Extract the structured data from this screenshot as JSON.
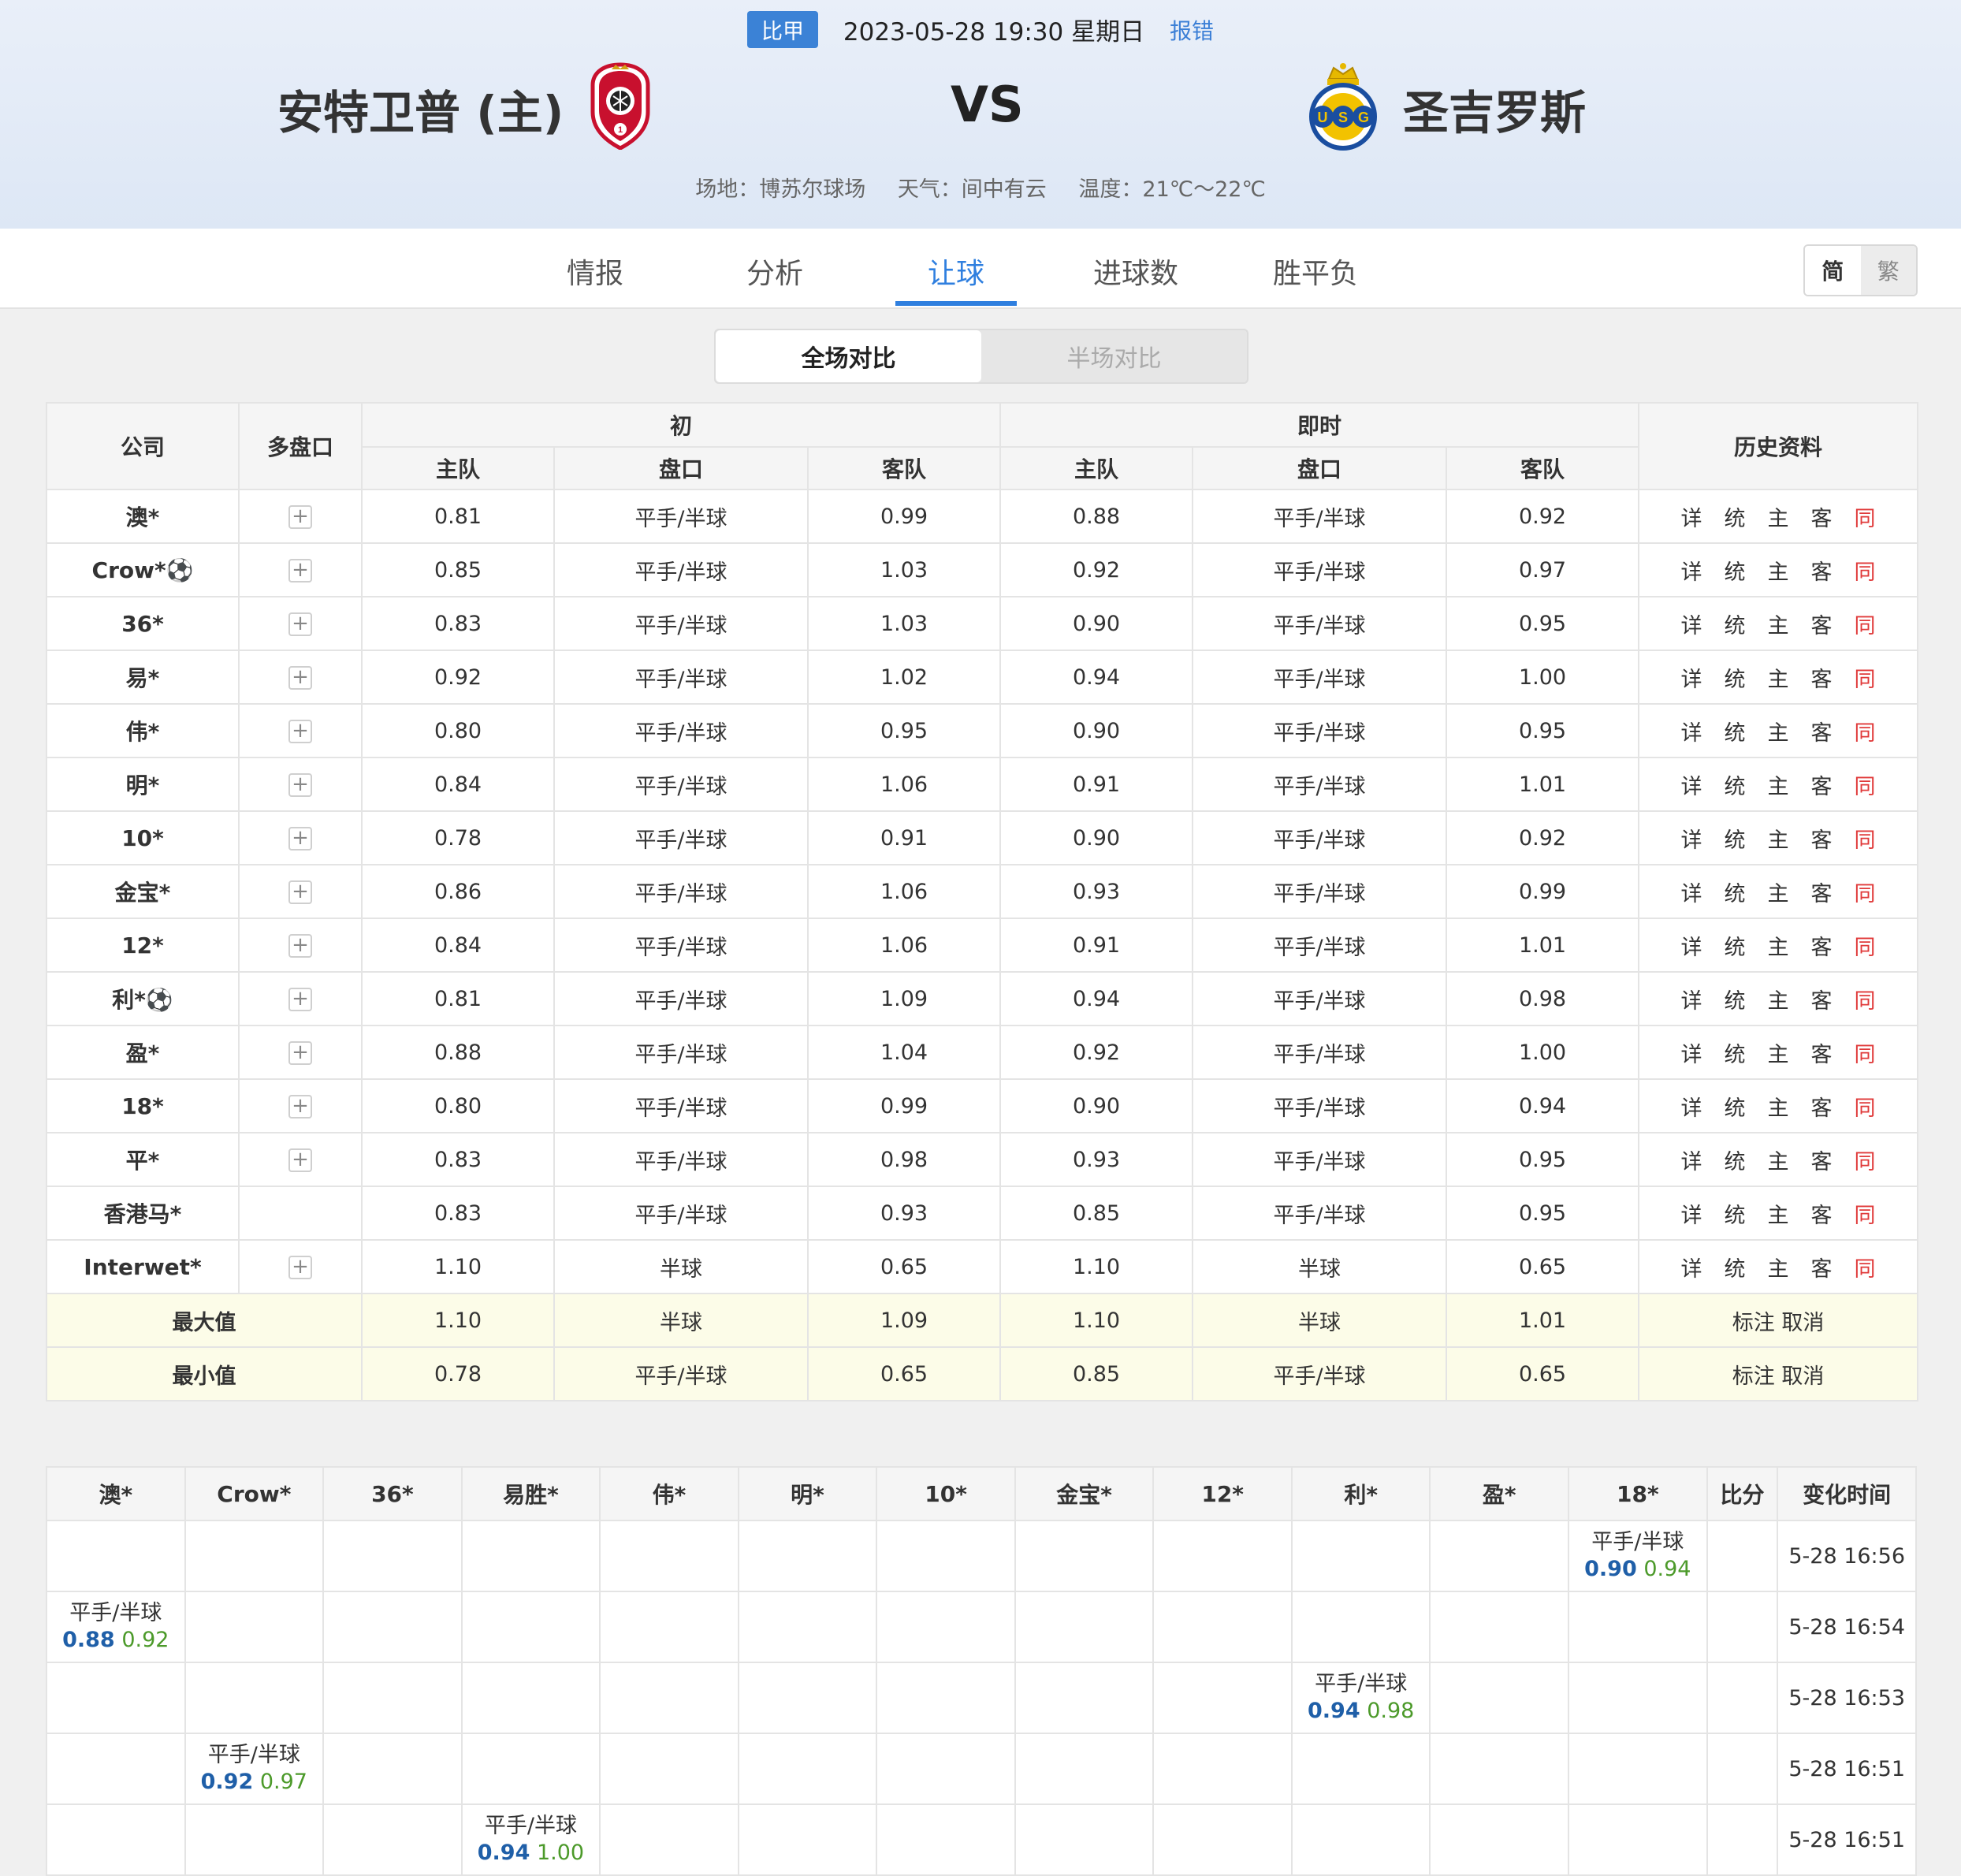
{
  "match": {
    "league": "比甲",
    "datetime": "2023-05-28 19:30 星期日",
    "report": "报错",
    "home_team": "安特卫普 (主)",
    "away_team": "圣吉罗斯",
    "vs": "VS",
    "venue": "场地：博苏尔球场",
    "weather": "天气：间中有云",
    "temperature": "温度：21℃～22℃"
  },
  "tabs": [
    "情报",
    "分析",
    "让球",
    "进球数",
    "胜平负"
  ],
  "active_tab": "让球",
  "lang": {
    "simp": "简",
    "trad": "繁"
  },
  "segment": {
    "full": "全场对比",
    "half": "半场对比"
  },
  "odds_table": {
    "headers": {
      "company": "公司",
      "multi": "多盘口",
      "initial": "初",
      "live": "即时",
      "history": "历史资料",
      "home": "主队",
      "line": "盘口",
      "away": "客队"
    },
    "history_links": [
      "详",
      "统",
      "主",
      "客",
      "同"
    ],
    "rows": [
      {
        "company": "澳*",
        "plus": true,
        "ih": "0.81",
        "il": "平手/半球",
        "ia": "0.99",
        "lh": "0.88",
        "ll": "平手/半球",
        "la": "0.92"
      },
      {
        "company": "Crow*⚽",
        "plus": true,
        "ih": "0.85",
        "il": "平手/半球",
        "ia": "1.03",
        "lh": "0.92",
        "ll": "平手/半球",
        "la": "0.97"
      },
      {
        "company": "36*",
        "plus": true,
        "ih": "0.83",
        "il": "平手/半球",
        "ia": "1.03",
        "lh": "0.90",
        "ll": "平手/半球",
        "la": "0.95"
      },
      {
        "company": "易*",
        "plus": true,
        "ih": "0.92",
        "il": "平手/半球",
        "ia": "1.02",
        "lh": "0.94",
        "ll": "平手/半球",
        "la": "1.00"
      },
      {
        "company": "伟*",
        "plus": true,
        "ih": "0.80",
        "il": "平手/半球",
        "ia": "0.95",
        "lh": "0.90",
        "ll": "平手/半球",
        "la": "0.95"
      },
      {
        "company": "明*",
        "plus": true,
        "ih": "0.84",
        "il": "平手/半球",
        "ia": "1.06",
        "lh": "0.91",
        "ll": "平手/半球",
        "la": "1.01"
      },
      {
        "company": "10*",
        "plus": true,
        "ih": "0.78",
        "il": "平手/半球",
        "ia": "0.91",
        "lh": "0.90",
        "ll": "平手/半球",
        "la": "0.92"
      },
      {
        "company": "金宝*",
        "plus": true,
        "ih": "0.86",
        "il": "平手/半球",
        "ia": "1.06",
        "lh": "0.93",
        "ll": "平手/半球",
        "la": "0.99"
      },
      {
        "company": "12*",
        "plus": true,
        "ih": "0.84",
        "il": "平手/半球",
        "ia": "1.06",
        "lh": "0.91",
        "ll": "平手/半球",
        "la": "1.01"
      },
      {
        "company": "利*⚽",
        "plus": true,
        "ih": "0.81",
        "il": "平手/半球",
        "ia": "1.09",
        "lh": "0.94",
        "ll": "平手/半球",
        "la": "0.98"
      },
      {
        "company": "盈*",
        "plus": true,
        "ih": "0.88",
        "il": "平手/半球",
        "ia": "1.04",
        "lh": "0.92",
        "ll": "平手/半球",
        "la": "1.00"
      },
      {
        "company": "18*",
        "plus": true,
        "ih": "0.80",
        "il": "平手/半球",
        "ia": "0.99",
        "lh": "0.90",
        "ll": "平手/半球",
        "la": "0.94"
      },
      {
        "company": "平*",
        "plus": true,
        "ih": "0.83",
        "il": "平手/半球",
        "ia": "0.98",
        "lh": "0.93",
        "ll": "平手/半球",
        "la": "0.95"
      },
      {
        "company": "香港马*",
        "plus": false,
        "ih": "0.83",
        "il": "平手/半球",
        "ia": "0.93",
        "lh": "0.85",
        "ll": "平手/半球",
        "la": "0.95"
      },
      {
        "company": "Interwet*",
        "plus": true,
        "ih": "1.10",
        "il": "半球",
        "ia": "0.65",
        "lh": "1.10",
        "ll": "半球",
        "la": "0.65"
      }
    ],
    "max": {
      "label": "最大值",
      "ih": "1.10",
      "il": "半球",
      "ia": "1.09",
      "lh": "1.10",
      "ll": "半球",
      "la": "1.01",
      "action": "标注 取消"
    },
    "min": {
      "label": "最小值",
      "ih": "0.78",
      "il": "平手/半球",
      "ia": "0.65",
      "lh": "0.85",
      "ll": "平手/半球",
      "la": "0.65",
      "action": "标注 取消"
    }
  },
  "change_table": {
    "headers": [
      "澳*",
      "Crow*",
      "36*",
      "易胜*",
      "伟*",
      "明*",
      "10*",
      "金宝*",
      "12*",
      "利*",
      "盈*",
      "18*",
      "比分",
      "变化时间"
    ],
    "rows": [
      {
        "col": 11,
        "line": "平手/半球",
        "home": "0.90",
        "away": "0.94",
        "time": "5-28 16:56"
      },
      {
        "col": 0,
        "line": "平手/半球",
        "home": "0.88",
        "away": "0.92",
        "time": "5-28 16:54"
      },
      {
        "col": 9,
        "line": "平手/半球",
        "home": "0.94",
        "away": "0.98",
        "time": "5-28 16:53"
      },
      {
        "col": 1,
        "line": "平手/半球",
        "home": "0.92",
        "away": "0.97",
        "time": "5-28 16:51"
      },
      {
        "col": 3,
        "line": "平手/半球",
        "home": "0.94",
        "away": "1.00",
        "time": "5-28 16:51"
      }
    ]
  }
}
